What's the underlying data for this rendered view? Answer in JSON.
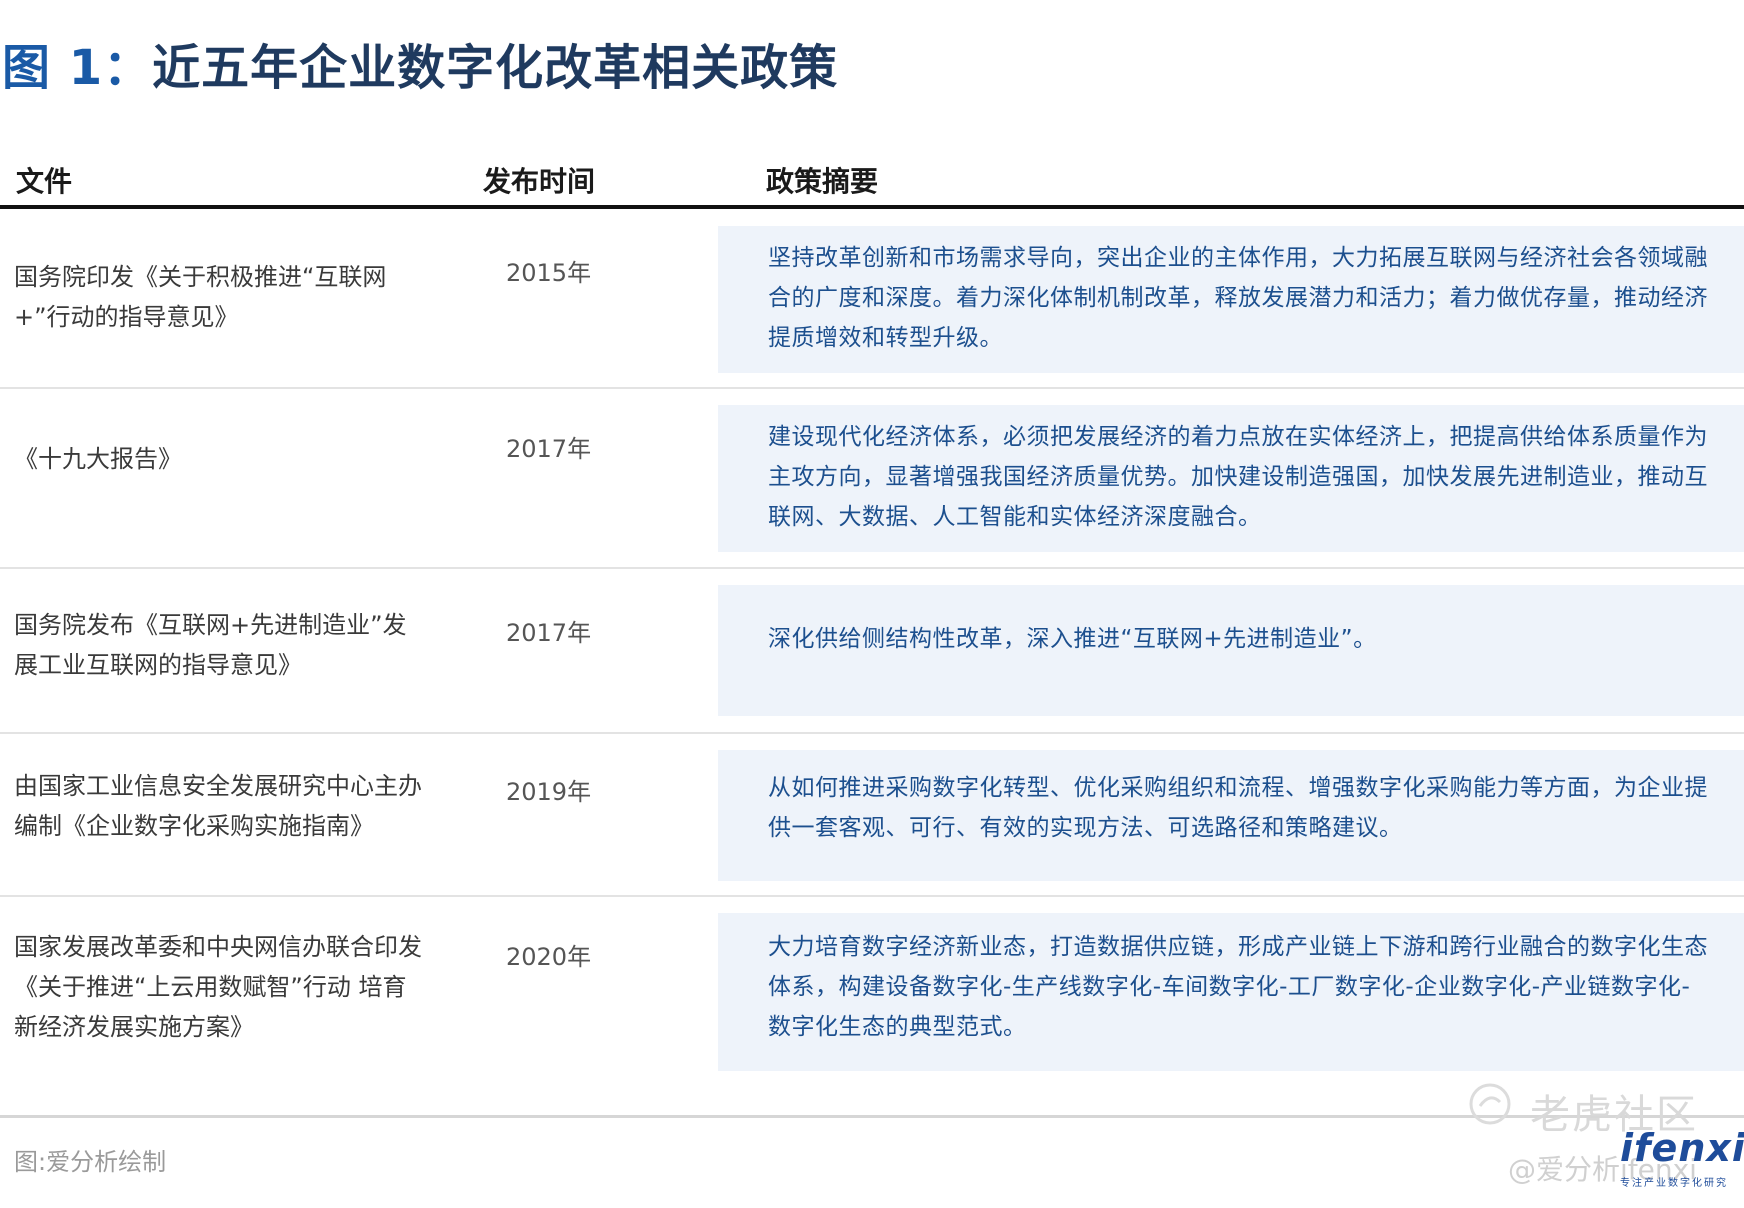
{
  "title": {
    "label": "图 1：",
    "text": "近五年企业数字化改革相关政策"
  },
  "table": {
    "headers": [
      "文件",
      "发布时间",
      "政策摘要"
    ],
    "rows": [
      {
        "document": "国务院印发《关于积极推进“互联网+”行动的指导意见》",
        "year": "2015年",
        "summary": "坚持改革创新和市场需求导向，突出企业的主体作用，大力拓展互联网与经济社会各领域融合的广度和深度。着力深化体制机制改革，释放发展潜力和活力；着力做优存量，推动经济提质增效和转型升级。"
      },
      {
        "document": "《十九大报告》",
        "year": "2017年",
        "summary": "建设现代化经济体系，必须把发展经济的着力点放在实体经济上，把提高供给体系质量作为主攻方向，显著增强我国经济质量优势。加快建设制造强国，加快发展先进制造业，推动互联网、大数据、人工智能和实体经济深度融合。"
      },
      {
        "document": "国务院发布《互联网+先进制造业”发展工业互联网的指导意见》",
        "year": "2017年",
        "summary": "深化供给侧结构性改革，深入推进“互联网+先进制造业”。"
      },
      {
        "document": "由国家工业信息安全发展研究中心主办编制《企业数字化采购实施指南》",
        "year": "2019年",
        "summary": "从如何推进采购数字化转型、优化采购组织和流程、增强数字化采购能力等方面，为企业提供一套客观、可行、有效的实现方法、可选路径和策略建议。"
      },
      {
        "document": "国家发展改革委和中央网信办联合印发《关于推进“上云用数赋智”行动 培育新经济发展实施方案》",
        "year": "2020年",
        "summary": "大力培育数字经济新业态，打造数据供应链，形成产业链上下游和跨行业融合的数字化生态体系，构建设备数字化-生产线数字化-车间数字化-工厂数字化-企业数字化-产业链数字化-数字化生态的典型范式。"
      }
    ]
  },
  "source": "图:爱分析绘制",
  "watermark": "老虎社区",
  "logo": {
    "name": "ifenxi",
    "tagline": "专注产业数字化研究"
  },
  "credit": "@爱分析ifenxi",
  "colors": {
    "title_accent": "#1a5aa6",
    "summary_text": "#1c4f8e",
    "summary_bg": "#eef3fa"
  }
}
